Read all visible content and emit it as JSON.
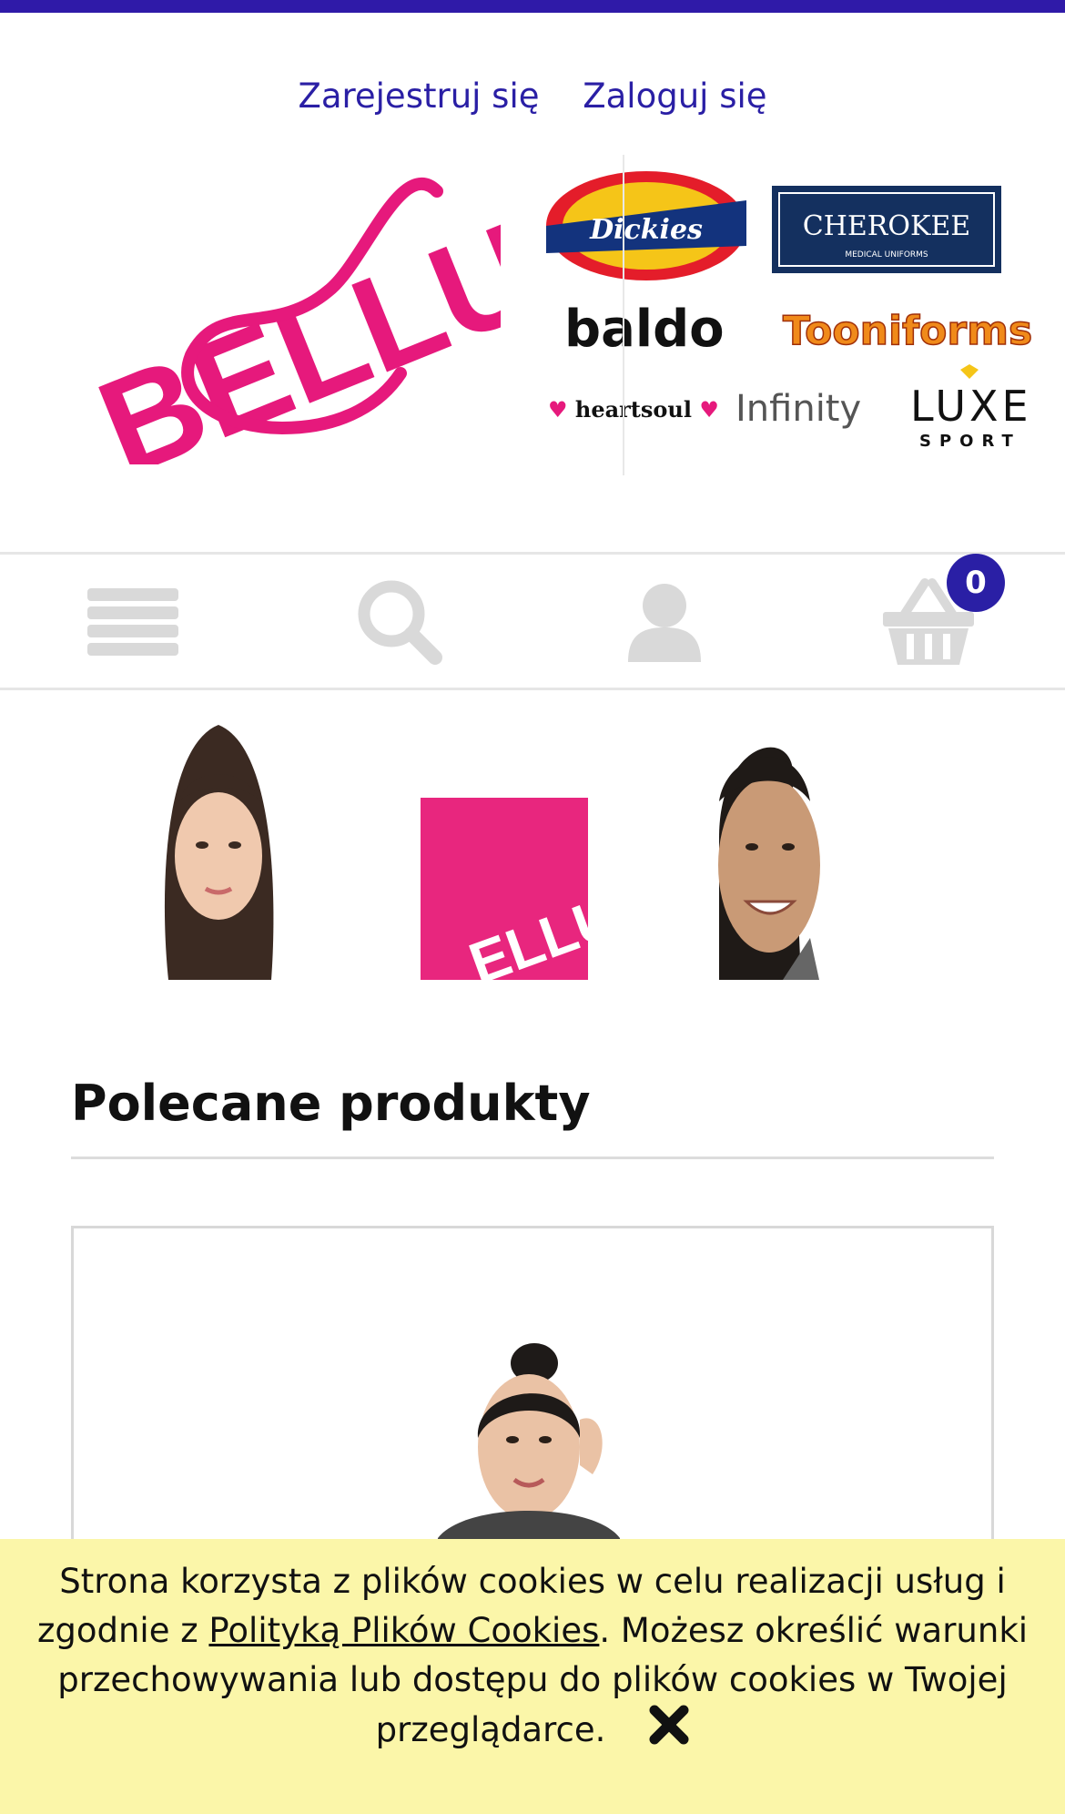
{
  "auth": {
    "register_label": "Zarejestruj się",
    "login_label": "Zaloguj się"
  },
  "logo": {
    "text": "BELLUS"
  },
  "brands": {
    "dickies": "Dickies",
    "cherokee": "CHEROKEE",
    "cherokee_sub": "MEDICAL UNIFORMS",
    "baldo": "baldo",
    "tooniforms": "Tooniforms",
    "heartsoul": "heartsoul",
    "infinity": "Infinity",
    "luxe": "LUXE",
    "luxe_sub": "SPORT"
  },
  "nav": {
    "menu_icon": "hamburger-icon",
    "search_icon": "search-icon",
    "account_icon": "user-icon",
    "cart_icon": "basket-icon",
    "cart_count": "0"
  },
  "hero": {
    "logo_text": "ELLUS"
  },
  "featured": {
    "title": "Polecane produkty"
  },
  "cookie": {
    "text_before": "Strona korzysta z plików cookies w celu realizacji usług i zgodnie z ",
    "link_text": "Polityką Plików Cookies",
    "text_after": ". Możesz określić warunki przechowywania lub dostępu do plików cookies w Twojej przeglądarce.",
    "close_icon": "close-icon"
  },
  "colors": {
    "accent": "#2a1fa5",
    "brand_pink": "#e6197c",
    "cookie_bg": "#fbf6a9",
    "icon_gray": "#d9d9d9"
  }
}
